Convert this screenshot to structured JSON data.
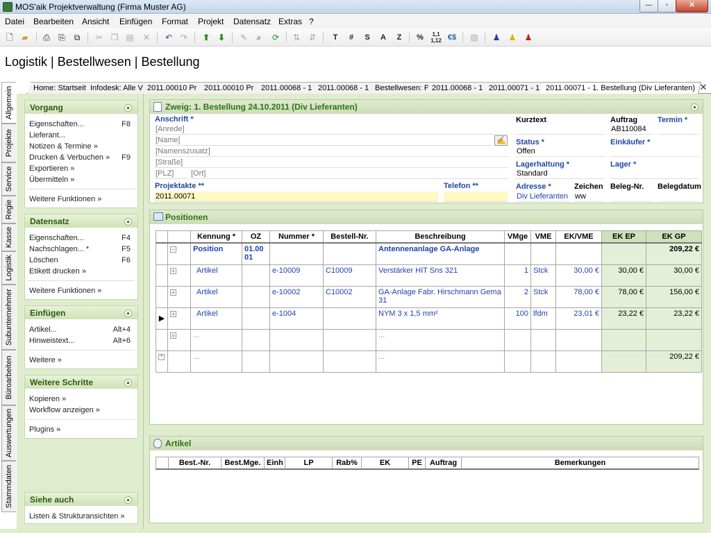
{
  "window": {
    "title": "MOS'aik Projektverwaltung (Firma Muster AG)",
    "min": "—",
    "max": "▫",
    "close": "✕"
  },
  "menu": [
    "Datei",
    "Bearbeiten",
    "Ansicht",
    "Einfügen",
    "Format",
    "Projekt",
    "Datensatz",
    "Extras",
    "?"
  ],
  "toolbar": {
    "t": "T",
    "hash": "#",
    "s": "S",
    "a": "A",
    "z": "Z",
    "percent": "%",
    "num": "1,1 1,12",
    "euro": "€$"
  },
  "breadcrumb": "Logistik | Bestellwesen | Bestellung",
  "tabs": [
    "Home: Startseite",
    "Infodesk: Alle V",
    "2011.00010 Pr",
    "2011.00010 Pr",
    "2011.00068 - 1",
    "2011.00068 - 1",
    "Bestellwesen: P",
    "2011.00068 - 1",
    "2011.00071 - 1",
    "2011.00071 - 1. Bestellung (Div Lieferanten)"
  ],
  "vtabs": [
    "Allgemein",
    "Projekte",
    "Service",
    "Regie",
    "Kasse",
    "Logistik",
    "Subunternehmer",
    "Büroarbeiten",
    "Auswertungen",
    "Stammdaten"
  ],
  "sidebar": {
    "vorgang": {
      "title": "Vorgang",
      "items": [
        {
          "label": "Eigenschaften...",
          "key": "F8"
        },
        {
          "label": "Lieferant...",
          "key": ""
        },
        {
          "label": "Notizen & Termine »",
          "key": ""
        },
        {
          "label": "Drucken & Verbuchen »",
          "key": "F9"
        },
        {
          "label": "Exportieren »",
          "key": ""
        },
        {
          "label": "Übermitteln »",
          "key": ""
        }
      ],
      "more": "Weitere Funktionen »"
    },
    "datensatz": {
      "title": "Datensatz",
      "items": [
        {
          "label": "Eigenschaften...",
          "key": "F4"
        },
        {
          "label": "Nachschlagen... *",
          "key": "F5"
        },
        {
          "label": "Löschen",
          "key": "F6"
        },
        {
          "label": "Etikett drucken »",
          "key": ""
        }
      ],
      "more": "Weitere Funktionen »"
    },
    "einfuegen": {
      "title": "Einfügen",
      "items": [
        {
          "label": "Artikel...",
          "key": "Alt+4"
        },
        {
          "label": "Hinweistext...",
          "key": "Alt+6"
        }
      ],
      "more": "Weitere »"
    },
    "schritte": {
      "title": "Weitere Schritte",
      "items": [
        {
          "label": "Kopieren »",
          "key": ""
        },
        {
          "label": "Workflow anzeigen »",
          "key": ""
        }
      ],
      "more": "Plugins »"
    },
    "siehe": {
      "title": "Siehe auch",
      "items": [
        {
          "label": "Listen & Strukturansichten »",
          "key": ""
        }
      ]
    }
  },
  "zweig": {
    "title": "Zweig: 1. Bestellung 24.10.2011 (Div Lieferanten)",
    "anschrift_label": "Anschrift *",
    "anrede": "[Anrede]",
    "name": "[Name]",
    "namenszusatz": "[Namenszusatz]",
    "strasse": "[Straße]",
    "plz": "[PLZ]",
    "ort": "[Ort]",
    "projektakte_label": "Projektakte **",
    "projektakte": "2011.00071",
    "telefon_label": "Telefon **",
    "telefon": "",
    "kurztext_label": "Kurztext",
    "kurztext": "",
    "auftrag_label": "Auftrag",
    "auftrag": "AB110084",
    "termin_label": "Termin *",
    "termin": "",
    "status_label": "Status *",
    "status": "Offen",
    "einkaeufer_label": "Einkäufer *",
    "einkaeufer": "",
    "lagerhaltung_label": "Lagerhaltung *",
    "lagerhaltung": "Standard",
    "lager_label": "Lager *",
    "lager": "",
    "adresse_label": "Adresse *",
    "adresse": "Div Lieferanten",
    "zeichen_label": "Zeichen",
    "zeichen": "ww",
    "belegnr_label": "Beleg-Nr.",
    "belegnr": "",
    "belegdatum_label": "Belegdatum",
    "belegdatum": ""
  },
  "positionen": {
    "title": "Positionen",
    "columns": [
      "Kennung *",
      "OZ",
      "Nummer *",
      "Bestell-Nr.",
      "Beschreibung",
      "VMge",
      "VME",
      "EK/VME",
      "EK EP",
      "EK GP"
    ],
    "rows": [
      {
        "kennung": "Position",
        "oz": "01.00 01",
        "nummer": "",
        "bestell": "",
        "beschreibung": "Antennenanlage GA-Anlage",
        "vmge": "",
        "vme": "",
        "ekvme": "",
        "ekep": "",
        "ekgp": "209,22 €"
      },
      {
        "kennung": "Artikel",
        "oz": "",
        "nummer": "e-10009",
        "bestell": "C10009",
        "beschreibung": "Verstärker HIT Sns 321",
        "vmge": "1",
        "vme": "Stck",
        "ekvme": "30,00 €",
        "ekep": "30,00 €",
        "ekgp": "30,00 €"
      },
      {
        "kennung": "Artikel",
        "oz": "",
        "nummer": "e-10002",
        "bestell": "C10002",
        "beschreibung": "GA-Anlage Fabr. Hirschmann Gema 31",
        "vmge": "2",
        "vme": "Stck",
        "ekvme": "78,00 €",
        "ekep": "78,00 €",
        "ekgp": "156,00 €"
      },
      {
        "kennung": "Artikel",
        "oz": "",
        "nummer": "e-1004",
        "bestell": "",
        "beschreibung": "NYM 3 x 1,5 mm²",
        "vmge": "100",
        "vme": "lfdm",
        "ekvme": "23,01 €",
        "ekep": "23,22 €",
        "ekgp": "23,22 €"
      },
      {
        "kennung": "...",
        "oz": "",
        "nummer": "",
        "bestell": "",
        "beschreibung": "...",
        "vmge": "",
        "vme": "",
        "ekvme": "",
        "ekep": "",
        "ekgp": ""
      },
      {
        "kennung": "...",
        "oz": "",
        "nummer": "",
        "bestell": "",
        "beschreibung": "...",
        "vmge": "",
        "vme": "",
        "ekvme": "",
        "ekep": "",
        "ekgp": "209,22 €"
      }
    ]
  },
  "artikel": {
    "title": "Artikel",
    "columns": [
      "Best.-Nr.",
      "Best.Mge.",
      "Einh",
      "LP",
      "Rab%",
      "EK",
      "PE",
      "Auftrag",
      "Bemerkungen"
    ]
  }
}
